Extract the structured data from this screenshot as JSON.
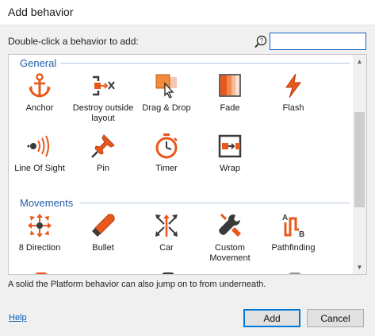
{
  "window": {
    "title": "Add behavior"
  },
  "search": {
    "hint": "Double-click a behavior to add:",
    "value": ""
  },
  "categories": [
    {
      "name": "General",
      "items": [
        {
          "label": "Anchor",
          "icon": "anchor-icon"
        },
        {
          "label": "Destroy outside layout",
          "icon": "destroy-outside-layout-icon"
        },
        {
          "label": "Drag & Drop",
          "icon": "drag-drop-icon"
        },
        {
          "label": "Fade",
          "icon": "fade-icon"
        },
        {
          "label": "Flash",
          "icon": "flash-icon"
        },
        {
          "label": "Line Of Sight",
          "icon": "line-of-sight-icon"
        },
        {
          "label": "Pin",
          "icon": "pin-icon"
        },
        {
          "label": "Timer",
          "icon": "timer-icon"
        },
        {
          "label": "Wrap",
          "icon": "wrap-icon"
        }
      ]
    },
    {
      "name": "Movements",
      "items": [
        {
          "label": "8 Direction",
          "icon": "eight-direction-icon"
        },
        {
          "label": "Bullet",
          "icon": "bullet-icon"
        },
        {
          "label": "Car",
          "icon": "car-icon"
        },
        {
          "label": "Custom Movement",
          "icon": "custom-movement-icon"
        },
        {
          "label": "Pathfinding",
          "icon": "pathfinding-icon"
        }
      ]
    }
  ],
  "status": {
    "text": "A solid the Platform behavior can also jump on to from underneath."
  },
  "footer": {
    "help_label": "Help",
    "add_label": "Add",
    "cancel_label": "Cancel"
  },
  "colors": {
    "accent": "#1f5fa8",
    "icon_orange": "#e8581c",
    "icon_dark": "#3a3a3a",
    "default_button_border": "#0078d7"
  }
}
